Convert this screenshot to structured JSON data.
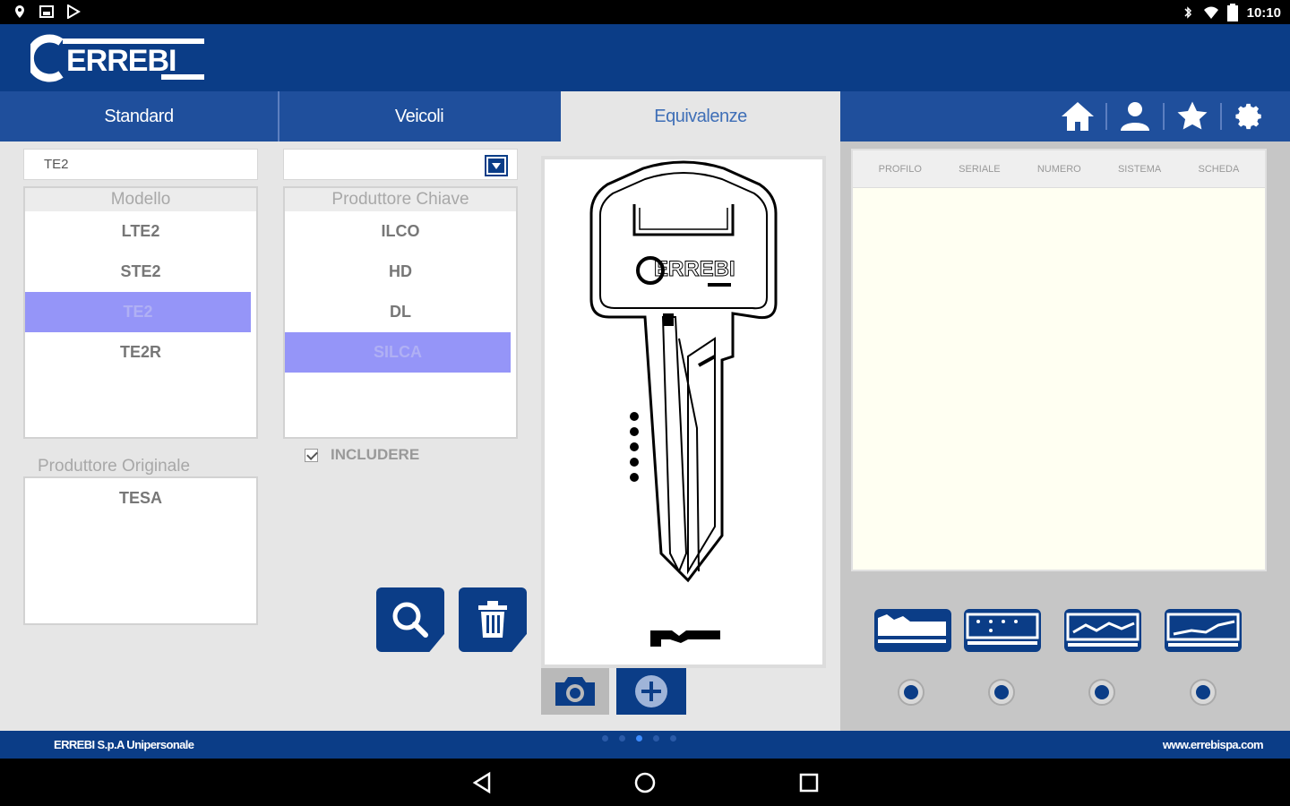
{
  "status_bar": {
    "time": "10:10"
  },
  "header": {
    "logo_text": "ERREBI"
  },
  "tabs": [
    {
      "label": "Standard"
    },
    {
      "label": "Veicoli"
    },
    {
      "label": "Equivalenze"
    }
  ],
  "search": {
    "model_value": "TE2",
    "manufacturer_value": ""
  },
  "modello_list": {
    "header": "Modello",
    "items": [
      "LTE2",
      "STE2",
      "TE2",
      "TE2R"
    ],
    "selected": "TE2"
  },
  "produttore_chiave_list": {
    "header": "Produttore Chiave",
    "items": [
      "ILCO",
      "HD",
      "DL",
      "SILCA"
    ],
    "selected": "SILCA"
  },
  "include_checkbox": {
    "label": "INCLUDERE",
    "checked": true
  },
  "produttore_originale": {
    "label": "Produttore Originale",
    "items": [
      "TESA"
    ]
  },
  "key_logo_text": "ERREBI",
  "results_table": {
    "columns": [
      "PROFILO",
      "SERIALE",
      "NUMERO",
      "SISTEMA",
      "SCHEDA"
    ]
  },
  "footer": {
    "company": "ERREBI S.p.A Unipersonale",
    "website": "www.errebispa.com"
  },
  "colors": {
    "brand": "#0b3d87",
    "selection": "#9595f8"
  }
}
